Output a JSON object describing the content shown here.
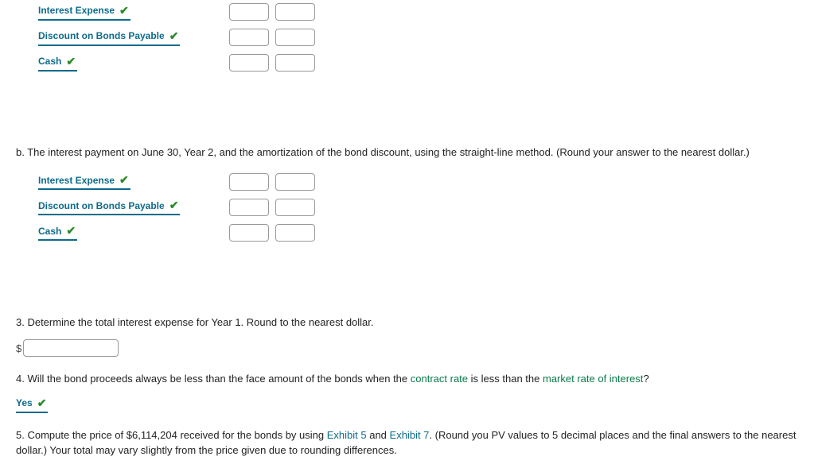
{
  "blockA": {
    "rows": [
      {
        "label": "Interest Expense"
      },
      {
        "label": "Discount on Bonds Payable"
      },
      {
        "label": "Cash"
      }
    ]
  },
  "qB": {
    "prompt": "b.  The interest payment on June 30, Year 2, and the amortization of the bond discount, using the straight-line method. (Round your answer to the nearest dollar.)",
    "rows": [
      {
        "label": "Interest Expense"
      },
      {
        "label": "Discount on Bonds Payable"
      },
      {
        "label": "Cash"
      }
    ]
  },
  "q3": {
    "prompt": "3.  Determine the total interest expense for Year 1. Round to the nearest dollar.",
    "currency": "$"
  },
  "q4": {
    "prefix": "4.  Will the bond proceeds always be less than the face amount of the bonds when the ",
    "term1": "contract rate",
    "mid": " is less than the ",
    "term2": "market rate of interest",
    "suffix": "?",
    "answer": "Yes"
  },
  "q5": {
    "prefix": "5.  Compute the price of $6,114,204 received for the bonds by using ",
    "link1": "Exhibit 5",
    "and": " and ",
    "link2": "Exhibit 7",
    "suffix": ". (Round you PV values to 5 decimal places and the final answers to the nearest dollar.) Your total may vary slightly from the price given due to rounding differences."
  }
}
